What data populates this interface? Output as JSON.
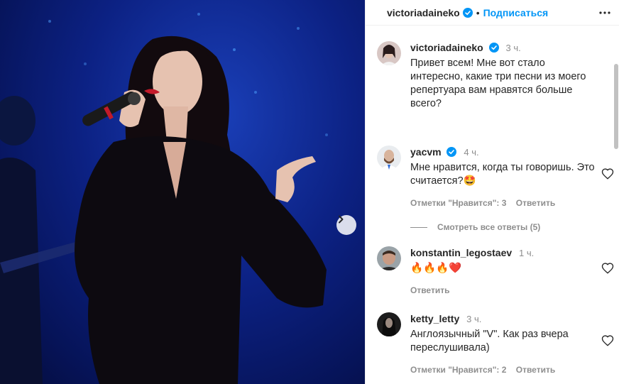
{
  "header": {
    "username": "victoriadaineko",
    "dot": "•",
    "follow_label": "Подписаться"
  },
  "icons": {
    "verified": "verified-badge-icon",
    "more": "more-options-icon",
    "heart": "heart-icon",
    "next": "chevron-right-icon"
  },
  "colors": {
    "accent": "#0095f6",
    "verified": "#0095f6",
    "muted": "#8e8e8e"
  },
  "caption": {
    "username": "victoriadaineko",
    "time": "3 ч.",
    "text": "Привет всем! Мне вот стало интересно, какие три песни из моего репертуара вам нравятся больше всего?"
  },
  "comments": [
    {
      "username": "yacvm",
      "time": "4 ч.",
      "text": "Мне нравится, когда ты говоришь. Это считается?🤩",
      "likes_label": "Отметки \"Нравится\": 3",
      "reply_label": "Ответить"
    },
    {
      "username": "konstantin_legostaev",
      "time": "1 ч.",
      "text": "🔥🔥🔥❤️",
      "reply_label": "Ответить"
    },
    {
      "username": "ketty_letty",
      "time": "3 ч.",
      "text": "Англоязычный \"V\". Как раз вчера переслушивала)",
      "likes_label": "Отметки \"Нравится\": 2",
      "reply_label": "Ответить"
    }
  ],
  "view_replies_label": "Смотреть все ответы (5)"
}
